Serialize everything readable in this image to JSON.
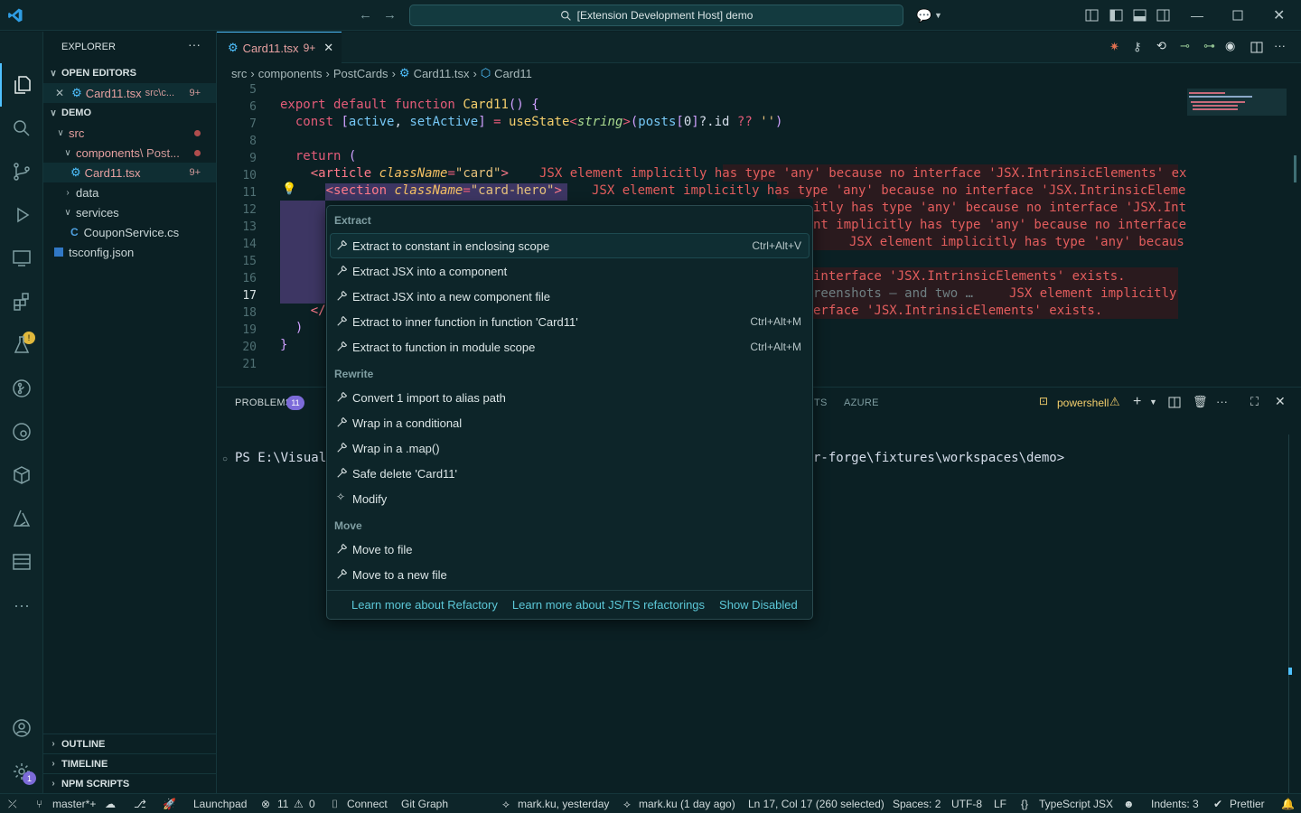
{
  "titlebar": {
    "title": "[Extension Development Host] demo"
  },
  "colors": {
    "accent": "#4fc1ff",
    "error": "#e35d5d",
    "background": "#0b2024",
    "link": "#5cc8d8",
    "badge": "#7c6bd9"
  },
  "activity": {
    "items": [
      "explorer-icon",
      "search-icon",
      "source-control-icon",
      "run-debug-icon",
      "remote-explorer-icon",
      "extensions-icon",
      "testing-icon",
      "git-graph-icon",
      "timeline-icon",
      "containers-icon",
      "azure-icon",
      "database-icon",
      "more-icon"
    ],
    "settings_badge": "1"
  },
  "sidebar": {
    "title": "EXPLORER",
    "open_editors": "OPEN EDITORS",
    "open_file": "Card11.tsx",
    "open_path": "src\\c...",
    "open_count": "9+",
    "root": "DEMO",
    "tree": {
      "src": "src",
      "components": "components",
      "components_sub": "\\ Post...",
      "card": "Card11.tsx",
      "card_count": "9+",
      "data": "data",
      "services": "services",
      "coupon": "CouponService.cs",
      "tsconfig": "tsconfig.json"
    },
    "outline": "OUTLINE",
    "timeline": "TIMELINE",
    "npm": "NPM SCRIPTS"
  },
  "tab": {
    "label": "Card11.tsx",
    "count": "9+"
  },
  "breadcrumb": [
    "src",
    "components",
    "PostCards",
    "Card11.tsx",
    "Card11"
  ],
  "editor": {
    "line_numbers": [
      "5",
      "6",
      "7",
      "8",
      "9",
      "10",
      "11",
      "12",
      "13",
      "14",
      "15",
      "16",
      "17",
      "18",
      "19",
      "20",
      "21"
    ],
    "errors": {
      "l10": "JSX element implicitly has type 'any' because no interface 'JSX.IntrinsicElements' ex",
      "l11": "JSX element implicitly has type 'any' because no interface 'JSX.IntrinsicEleme",
      "l12": "itly has type 'any' because no interface 'JSX.Int",
      "l13": "nt implicitly has type 'any' because no interface",
      "l14": "JSX element implicitly has type 'any' becaus",
      "l16": "interface 'JSX.IntrinsicElements' exists.",
      "l17a": "reenshots — and two …",
      "l17b": "JSX element implicitly",
      "l18": "erface 'JSX.IntrinsicElements' exists."
    }
  },
  "menu": {
    "groups": [
      "Extract",
      "Rewrite",
      "Move"
    ],
    "extract": [
      {
        "label": "Extract to constant in enclosing scope",
        "kb": "Ctrl+Alt+V"
      },
      {
        "label": "Extract JSX into a component",
        "kb": ""
      },
      {
        "label": "Extract JSX into a new component file",
        "kb": ""
      },
      {
        "label": "Extract to inner function in function 'Card11'",
        "kb": "Ctrl+Alt+M"
      },
      {
        "label": "Extract to function in module scope",
        "kb": "Ctrl+Alt+M"
      }
    ],
    "rewrite": [
      {
        "label": "Convert 1 import to alias path"
      },
      {
        "label": "Wrap in a conditional"
      },
      {
        "label": "Wrap in a .map()"
      },
      {
        "label": "Safe delete 'Card11'"
      },
      {
        "label": "Modify"
      }
    ],
    "move": [
      {
        "label": "Move to file"
      },
      {
        "label": "Move to a new file"
      }
    ],
    "footer": [
      "Learn more about Refactory",
      "Learn more about JS/TS refactorings",
      "Show Disabled"
    ]
  },
  "panel": {
    "problems": "PROBLEMS",
    "problems_count": "11",
    "ports_tail": "TS",
    "azure": "AZURE",
    "terminal_name": "powershell",
    "prompt_left": "PS E:\\VisualS",
    "prompt_right": "r-forge\\fixtures\\workspaces\\demo>"
  },
  "status": {
    "branch": "master*+",
    "launchpad": "Launchpad",
    "errors": "11",
    "warnings": "0",
    "connect": "Connect",
    "gitgraph": "Git Graph",
    "blame1": "mark.ku, yesterday",
    "blame2": "mark.ku (1 day ago)",
    "position": "Ln 17, Col 17 (260 selected)",
    "spaces": "Spaces: 2",
    "encoding": "UTF-8",
    "eol": "LF",
    "language": "TypeScript JSX",
    "indents": "Indents: 3",
    "prettier": "Prettier"
  }
}
